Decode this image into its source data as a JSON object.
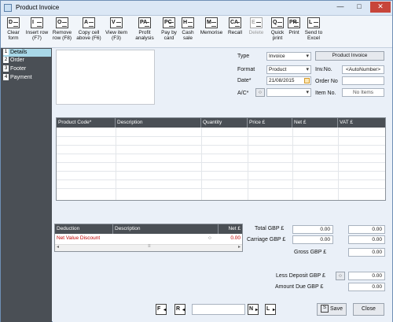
{
  "window": {
    "title": "Product Invoice",
    "min": "—",
    "max": "□",
    "close": "✕"
  },
  "toolbar": [
    {
      "key": "D",
      "label": "Clear form"
    },
    {
      "key": "I",
      "label": "Insert row (F7)"
    },
    {
      "key": "O",
      "label": "Remove row (F8)"
    },
    {
      "key": "A",
      "label": "Copy cell above (F6)"
    },
    {
      "key": "V",
      "label": "View item (F3)"
    },
    {
      "key": "PA",
      "label": "Profit analysis"
    },
    {
      "key": "PC",
      "label": "Pay by card"
    },
    {
      "key": "H",
      "label": "Cash sale"
    },
    {
      "key": "M",
      "label": "Memorise"
    },
    {
      "key": "CA",
      "label": "Recall"
    },
    {
      "key": "E",
      "label": "Delete"
    },
    {
      "key": "Q",
      "label": "Quick print"
    },
    {
      "key": "PR",
      "label": "Print"
    },
    {
      "key": "L",
      "label": "Send to Excel"
    }
  ],
  "sidebar": [
    {
      "num": "1",
      "label": "Details"
    },
    {
      "num": "2",
      "label": "Order"
    },
    {
      "num": "3",
      "label": "Footer"
    },
    {
      "num": "4",
      "label": "Payment"
    }
  ],
  "form": {
    "type_label": "Type",
    "type_value": "Invoice",
    "format_label": "Format",
    "format_value": "Product",
    "date_label": "Date*",
    "date_value": "21/08/2015",
    "ac_label": "A/C*",
    "ac_value": "",
    "product_invoice_btn": "Product Invoice",
    "invno_label": "Inv.No.",
    "invno_value": "<AutoNumber>",
    "orderno_label": "Order No",
    "orderno_value": "",
    "itemno_label": "Item No.",
    "itemno_value": "No Items"
  },
  "grid": {
    "columns": [
      "Product Code*",
      "Description",
      "Quantity",
      "Price £",
      "Net £",
      "VAT £"
    ]
  },
  "deductions": {
    "columns": [
      "Deduction",
      "Description",
      "Net £"
    ],
    "rows": [
      {
        "deduction": "Net Value Discount",
        "description": "",
        "net": "0.00"
      }
    ]
  },
  "totals": {
    "total_label": "Total GBP £",
    "total_net": "0.00",
    "total_vat": "0.00",
    "carriage_label": "Carriage GBP £",
    "carriage_net": "0.00",
    "carriage_vat": "0.00",
    "gross_label": "Gross GBP £",
    "gross_value": "0.00",
    "deposit_label": "Less Deposit GBP £",
    "deposit_value": "0.00",
    "amount_due_label": "Amount Due GBP £",
    "amount_due_value": "0.00"
  },
  "bottom": {
    "first_key": "F",
    "prev_key": "R",
    "next_key": "N",
    "last_key": "L",
    "page_value": "",
    "save_key": "S",
    "save_label": "Save",
    "close_label": "Close"
  }
}
